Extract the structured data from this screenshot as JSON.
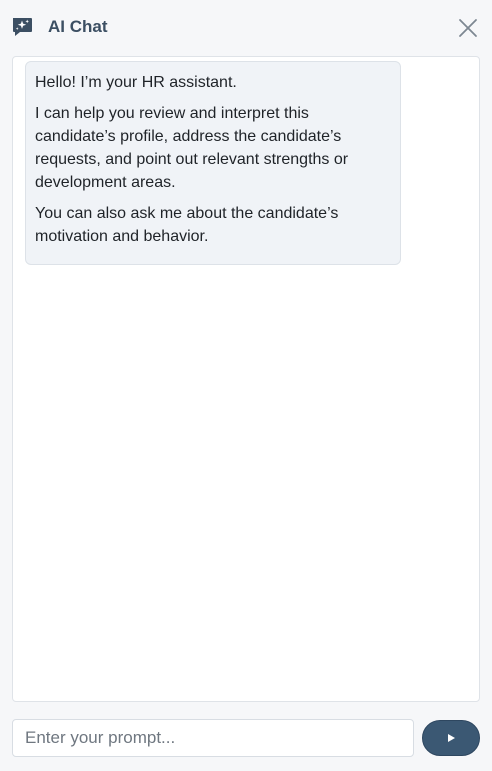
{
  "header": {
    "title": "AI Chat",
    "logo_icon": "ai-chat-sparkle-icon",
    "close_icon": "close-icon"
  },
  "messages": [
    {
      "role": "assistant",
      "paragraphs": [
        "Hello! I’m your HR assistant.",
        "I can help you review and interpret this candidate’s profile, address the candidate’s requests, and point out relevant strengths or development areas.",
        "You can also ask me about the candidate’s motivation and behavior."
      ]
    }
  ],
  "composer": {
    "placeholder": "Enter your prompt...",
    "value": "",
    "send_icon": "play-send-icon"
  },
  "colors": {
    "accent": "#3b5873",
    "title": "#3c4f63",
    "bubble_bg": "#f0f3f7",
    "page_bg": "#f6f7f9"
  }
}
